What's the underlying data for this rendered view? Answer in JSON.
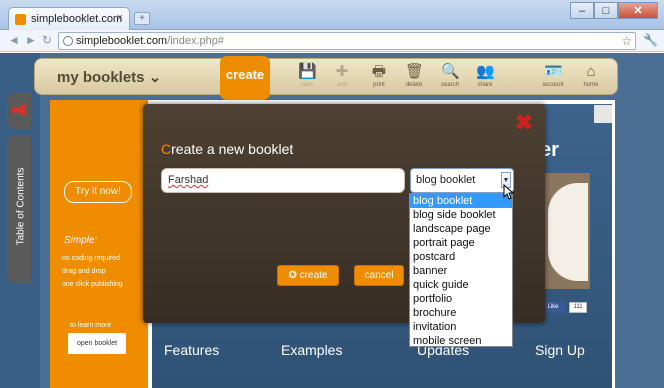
{
  "browser": {
    "tab_title": "simplebooklet.com",
    "tab_close": "×",
    "new_tab": "+",
    "window_buttons": {
      "minimize": "–",
      "maximize": "□",
      "close": "✕"
    },
    "nav": {
      "back": "◄",
      "forward": "►",
      "reload": "↻"
    },
    "url_host": "simplebooklet.com",
    "url_path": "/index.php#",
    "bookmark_star": "☆",
    "wrench": "🔧"
  },
  "header": {
    "brand": "my booklets ⌄",
    "create": "create",
    "tools": [
      {
        "label": "save",
        "icon": "floppy-icon",
        "glyph": "💾"
      },
      {
        "label": "add",
        "icon": "plus-icon",
        "glyph": "✚"
      },
      {
        "label": "print",
        "icon": "printer-icon",
        "glyph": "🖶"
      },
      {
        "label": "delete",
        "icon": "trash-icon",
        "glyph": "🗑"
      },
      {
        "label": "search",
        "icon": "magnifier-icon",
        "glyph": "🔍"
      },
      {
        "label": "share",
        "icon": "people-icon",
        "glyph": "👥"
      },
      {
        "label": "account",
        "icon": "id-card-icon",
        "glyph": "🪪"
      },
      {
        "label": "home",
        "icon": "house-icon",
        "glyph": "⌂"
      }
    ]
  },
  "sidebar": {
    "toc_label": "Table of Contents"
  },
  "promo": {
    "try_button": "Try it now!",
    "simple": "Simple:",
    "features": [
      "no coding required",
      "drag and drop",
      "one click publishing"
    ],
    "learn_more": "to learn more",
    "open_booklet": "open booklet"
  },
  "background": {
    "heading_fragment": "er",
    "like": "Like",
    "like_count": "111",
    "nav_links": [
      "Features",
      "Examples",
      "Updates",
      "Sign Up"
    ]
  },
  "dialog": {
    "title_first_letter": "C",
    "title_rest": "reate a new booklet",
    "close_icon": "✖",
    "name_value": "Farshad",
    "select_value": "blog booklet",
    "select_arrow": "▼",
    "options": [
      "blog booklet",
      "blog side booklet",
      "landscape page",
      "portrait page",
      "postcard",
      "banner",
      "quick guide",
      "portfolio",
      "brochure",
      "invitation",
      "mobile screen"
    ],
    "selected_index": 0,
    "create_button": "create",
    "cancel_button": "cancel"
  },
  "colors": {
    "accent_orange": "#f08c00",
    "dialog_bg": "#3f3529",
    "selection_blue": "#3399ff"
  }
}
